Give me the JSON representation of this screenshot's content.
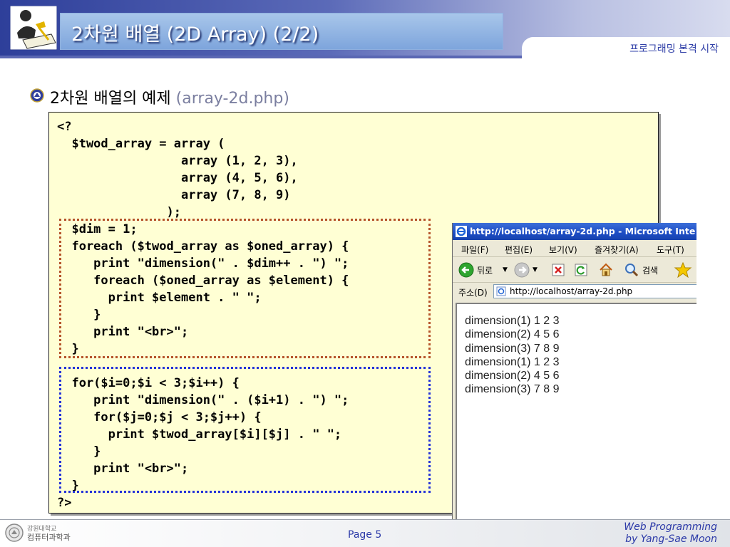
{
  "slide": {
    "title": "2차원 배열 (2D Array) (2/2)",
    "subtitle": "프로그래밍 본격 시작",
    "heading_main": "2차원 배열의 예제",
    "heading_file": "(array-2d.php)"
  },
  "code_lines": [
    "<?",
    "  $twod_array = array (",
    "                 array (1, 2, 3),",
    "                 array (4, 5, 6),",
    "                 array (7, 8, 9)",
    "               );",
    "  $dim = 1;",
    "  foreach ($twod_array as $oned_array) {",
    "     print \"dimension(\" . $dim++ . \") \";",
    "     foreach ($oned_array as $element) {",
    "       print $element . \" \";",
    "     }",
    "     print \"<br>\";",
    "  }",
    "",
    "  for($i=0;$i < 3;$i++) {",
    "     print \"dimension(\" . ($i+1) . \") \";",
    "     for($j=0;$j < 3;$j++) {",
    "       print $twod_array[$i][$j] . \" \";",
    "     }",
    "     print \"<br>\";",
    "  }",
    "?>"
  ],
  "browser": {
    "title": "http://localhost/array-2d.php - Microsoft Inte",
    "menu": [
      "파일(F)",
      "편집(E)",
      "보기(V)",
      "즐겨찾기(A)",
      "도구(T)"
    ],
    "back_label": "뒤로",
    "search_label": "검색",
    "address_label": "주소(D)",
    "address": "http://localhost/array-2d.php",
    "output": [
      "dimension(1) 1 2 3",
      "dimension(2) 4 5 6",
      "dimension(3) 7 8 9",
      "dimension(1) 1 2 3",
      "dimension(2) 4 5 6",
      "dimension(3) 7 8 9"
    ]
  },
  "footer": {
    "dept_line1": "강원대학교",
    "dept_line2": "컴퓨터과학과",
    "page": "Page 5",
    "credit_line1": "Web Programming",
    "credit_line2": "by Yang-Sae Moon"
  },
  "colors": {
    "header_blue": "#2e3f9a",
    "code_bg": "#ffffd4",
    "brown_box": "#b5542a",
    "blue_box": "#2433d8",
    "accent_text": "#2c3aa8"
  },
  "icons": {
    "logo": "person-at-desk-icon",
    "bullet": "university-seal-icon",
    "browser": "ie-icon"
  }
}
